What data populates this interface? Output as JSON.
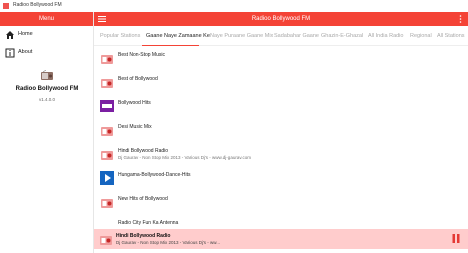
{
  "window": {
    "title": "Radioo Bollywood FM"
  },
  "sidebar": {
    "header": "Menu",
    "items": [
      {
        "label": "Home",
        "icon": "home-icon"
      },
      {
        "label": "About",
        "icon": "info-icon"
      }
    ],
    "app_name": "Radioo Bollywood FM",
    "version": "v1.4.0.0"
  },
  "appbar": {
    "title": "Radioo Bollywood FM"
  },
  "tabs": [
    {
      "label": "Popular Stations"
    },
    {
      "label": "Gaane Naye Zamaane Ke"
    },
    {
      "label": "Naye Puraane Gaane Mix"
    },
    {
      "label": "Sadabahar Gaane"
    },
    {
      "label": "Ghazin-E-Ghazal"
    },
    {
      "label": "All India Radio"
    },
    {
      "label": "Regional"
    },
    {
      "label": "All Stations"
    }
  ],
  "stations": [
    {
      "title": "Best Non-Stop Music",
      "subtitle": ""
    },
    {
      "title": "Best of Bollywood",
      "subtitle": ""
    },
    {
      "title": "Bollywood Hits",
      "subtitle": ""
    },
    {
      "title": "Desi Music Mix",
      "subtitle": ""
    },
    {
      "title": "Hindi Bollywood Radio",
      "subtitle": "Dj Gaurav - Non Stop Mix 2013 - Various Dj's - www.dj-gaurav.com"
    },
    {
      "title": "Hungama-Bollywood-Dance-Hits",
      "subtitle": ""
    },
    {
      "title": "New Hits of Bollywood",
      "subtitle": ""
    },
    {
      "title": "Radio City Fun Ka Antenna",
      "subtitle": ""
    }
  ],
  "player": {
    "title": "Hindi Bollywood Radio",
    "subtitle": "Dj Gaurav - Non Stop Mix 2013 - Various Dj's - ww..."
  },
  "colors": {
    "accent": "#f44336",
    "player_bg": "#ffcccc"
  }
}
